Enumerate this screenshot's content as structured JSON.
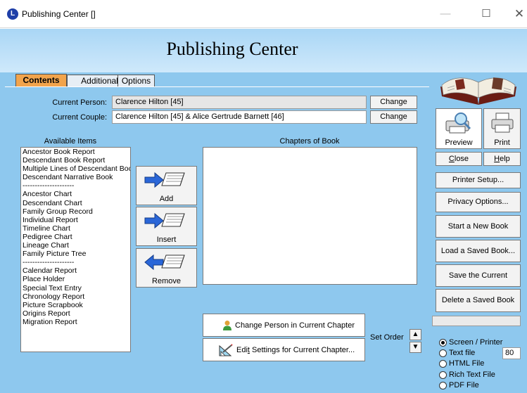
{
  "window": {
    "title": "Publishing Center []",
    "app_icon_letter": "L",
    "controls": {
      "minimize": "—",
      "maximize": "☐",
      "close": "✕"
    }
  },
  "header": {
    "title": "Publishing Center"
  },
  "tabs": [
    {
      "label": "Contents",
      "active": true
    },
    {
      "label": "Additional",
      "active": false
    },
    {
      "label": "Options",
      "active": false
    }
  ],
  "person": {
    "current_person_label": "Current Person:",
    "current_person_value": "Clarence Hilton [45]",
    "current_couple_label": "Current Couple:",
    "current_couple_value": "Clarence Hilton [45] & Alice Gertrude Barnett [46]",
    "change_label": "Change"
  },
  "available": {
    "heading": "Available Items",
    "items": [
      "Ancestor Book Report",
      "Descendant Book Report",
      "Multiple Lines of Descendant Boc",
      "Descendant Narrative Book",
      "---------------------",
      "Ancestor Chart",
      "Descendant Chart",
      "Family Group Record",
      "Individual Report",
      "Timeline Chart",
      "Pedigree Chart",
      "Lineage Chart",
      "Family Picture Tree",
      "---------------------",
      "Calendar Report",
      "Place Holder",
      "Special Text Entry",
      "Chronology Report",
      "Picture Scrapbook",
      "Origins Report",
      "Migration Report"
    ]
  },
  "chapters": {
    "heading": "Chapters of Book"
  },
  "actions": {
    "add": "Add",
    "insert": "Insert",
    "remove": "Remove"
  },
  "chapter_buttons": {
    "change_person": "Change Person in Current Chapter",
    "edit_settings_pre": "Edi",
    "edit_settings_underlined": "t",
    "edit_settings_post": " Settings for Current Chapter..."
  },
  "set_order": {
    "label": "Set Order",
    "up": "▲",
    "down": "▼"
  },
  "sidebar": {
    "preview": "Preview",
    "print": "Print",
    "close_u": "C",
    "close_rest": "lose",
    "help_u": "H",
    "help_rest": "elp",
    "buttons": [
      "Printer Setup...",
      "Privacy Options...",
      "Start a New Book",
      "Load a Saved Book...",
      "Save the Current Book...",
      "Delete a Saved Book"
    ]
  },
  "output": {
    "options": [
      {
        "label": "Screen / Printer",
        "checked": true
      },
      {
        "label": "Text file",
        "checked": false
      },
      {
        "label": "HTML File",
        "checked": false
      },
      {
        "label": "Rich Text File",
        "checked": false
      },
      {
        "label": "PDF File",
        "checked": false
      }
    ],
    "text_width": "80"
  },
  "colors": {
    "panel": "#8ec8ee",
    "header_top": "#a9d6f5",
    "active_tab": "#f2a44c",
    "app_icon": "#1f3fa8"
  }
}
